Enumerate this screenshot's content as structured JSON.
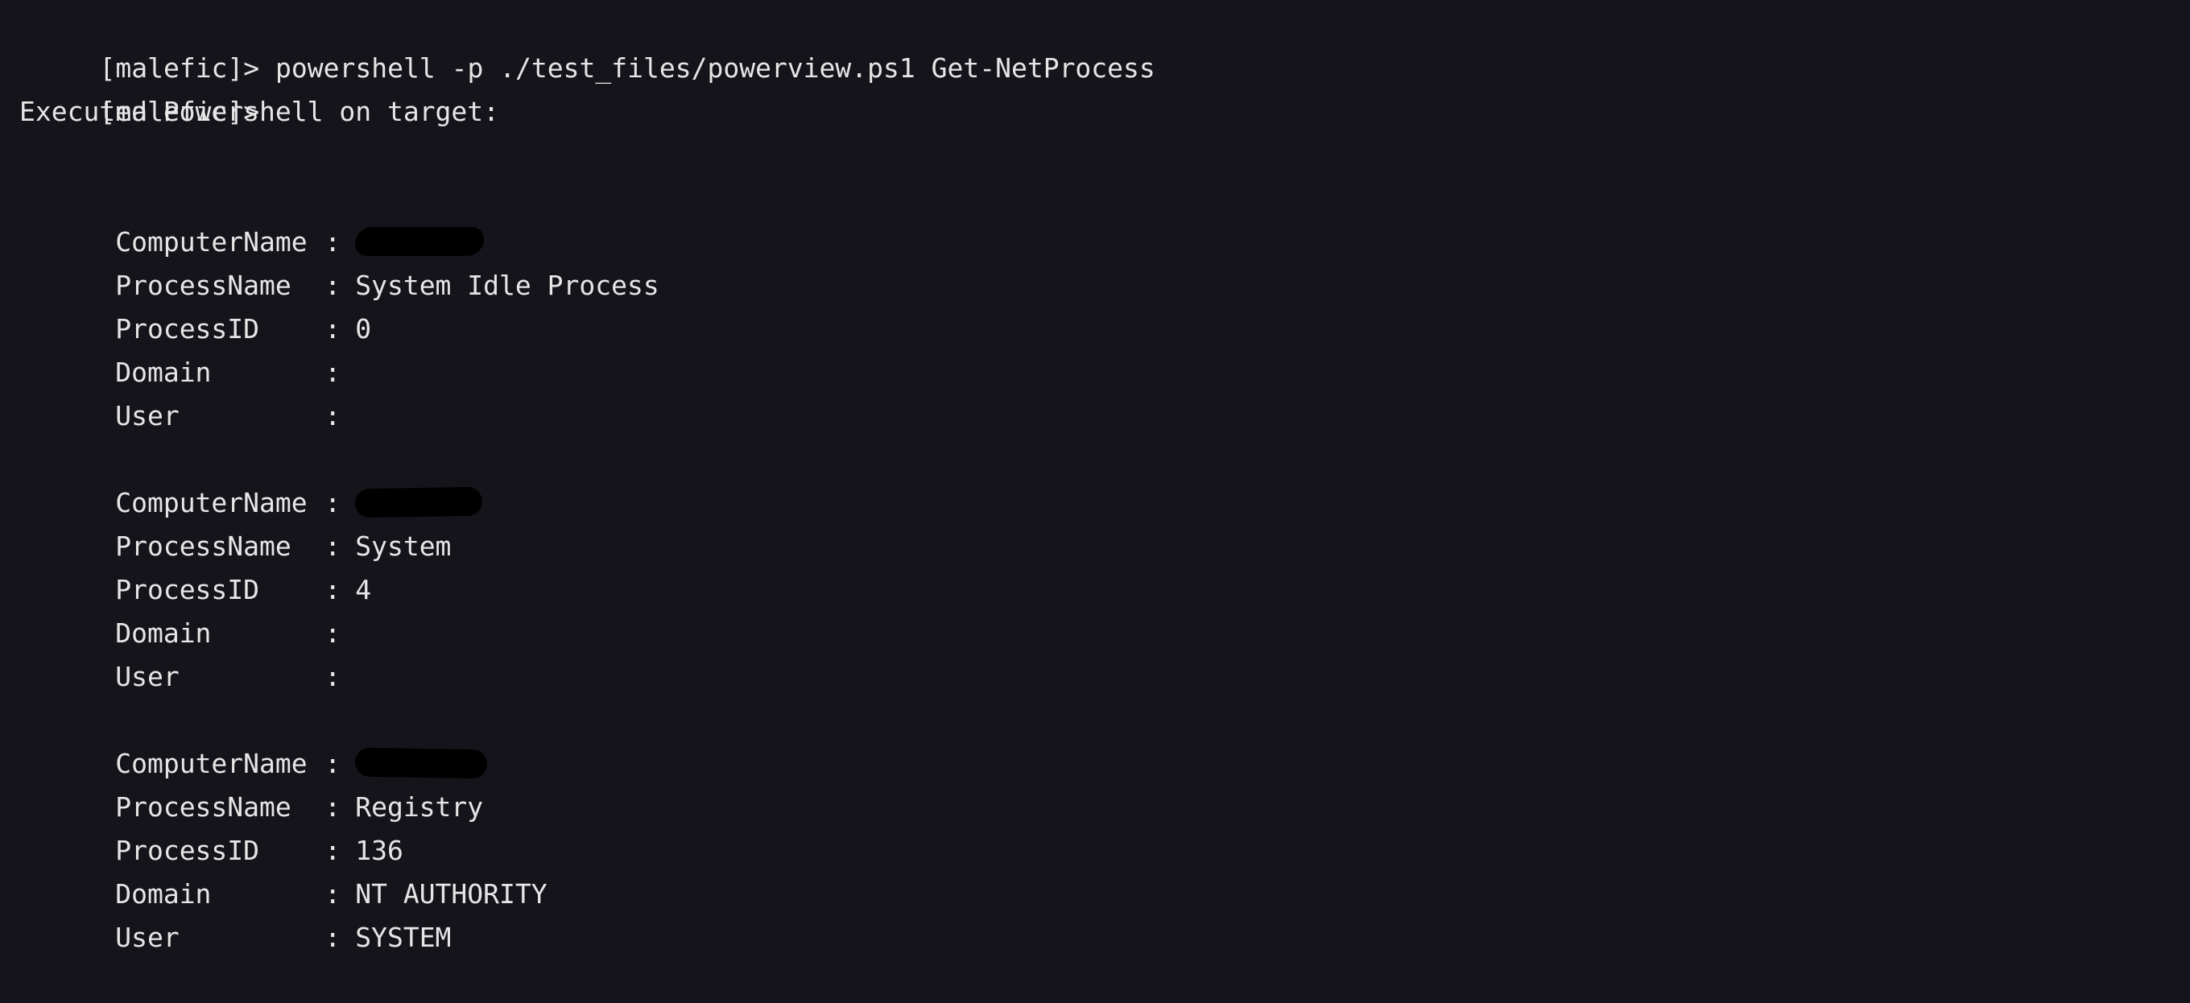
{
  "terminal": {
    "prompt": "[malefic]>",
    "command": "powershell -p ./test_files/powerview.ps1 Get-NetProcess",
    "status": "Executed Powershell on target:",
    "separator": ":",
    "records": [
      {
        "fields": [
          {
            "key": "ComputerName",
            "value": "",
            "redacted": true
          },
          {
            "key": "ProcessName",
            "value": "System Idle Process"
          },
          {
            "key": "ProcessID",
            "value": "0"
          },
          {
            "key": "Domain",
            "value": ""
          },
          {
            "key": "User",
            "value": ""
          }
        ]
      },
      {
        "fields": [
          {
            "key": "ComputerName",
            "value": "",
            "redacted": true
          },
          {
            "key": "ProcessName",
            "value": "System"
          },
          {
            "key": "ProcessID",
            "value": "4"
          },
          {
            "key": "Domain",
            "value": ""
          },
          {
            "key": "User",
            "value": ""
          }
        ]
      },
      {
        "fields": [
          {
            "key": "ComputerName",
            "value": "",
            "redacted": true
          },
          {
            "key": "ProcessName",
            "value": "Registry"
          },
          {
            "key": "ProcessID",
            "value": "136"
          },
          {
            "key": "Domain",
            "value": "NT AUTHORITY"
          },
          {
            "key": "User",
            "value": "SYSTEM"
          }
        ]
      }
    ]
  },
  "colors": {
    "background": "#16141b",
    "foreground": "#e6e6e6",
    "redaction": "#000000"
  }
}
